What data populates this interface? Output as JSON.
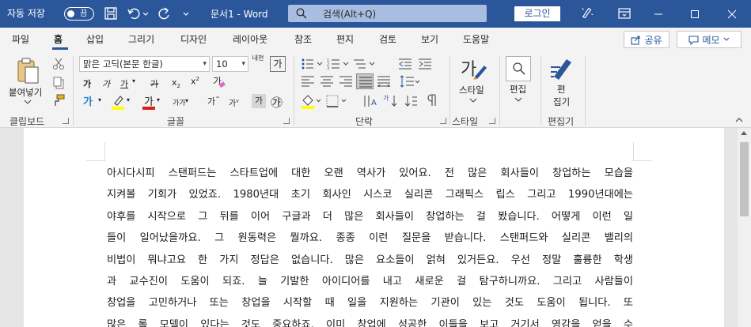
{
  "titlebar": {
    "autosave_label": "자동 저장",
    "autosave_state": "끔",
    "document_title": "문서1 - Word",
    "search_placeholder": "검색(Alt+Q)",
    "login_label": "로그인"
  },
  "tabs": [
    {
      "label": "파일"
    },
    {
      "label": "홈"
    },
    {
      "label": "삽입"
    },
    {
      "label": "그리기"
    },
    {
      "label": "디자인"
    },
    {
      "label": "레이아웃"
    },
    {
      "label": "참조"
    },
    {
      "label": "편지"
    },
    {
      "label": "검토"
    },
    {
      "label": "보기"
    },
    {
      "label": "도움말"
    }
  ],
  "active_tab": "홈",
  "share_label": "공유",
  "memo_label": "메모",
  "ribbon": {
    "clipboard": {
      "paste_label": "붙여넣기",
      "group_label": "클립보드"
    },
    "font": {
      "font_name": "맑은 고딕(본문 한글)",
      "font_size": "10",
      "phonetic": "내천",
      "big_letter": "가",
      "bold": "가",
      "italic": "가",
      "underline": "가",
      "strike": "가",
      "subscript": "x",
      "superscript": "x",
      "highlight_text": "가",
      "font_color_text": "가",
      "char_shading": "가가",
      "grow": "가",
      "shrink": "가",
      "char_border": "가",
      "enclosed": "㉮",
      "group_label": "글꼴"
    },
    "paragraph": {
      "group_label": "단락"
    },
    "styles": {
      "style_label": "스타일",
      "group_label": "스타일"
    },
    "editing": {
      "edit_label": "편집",
      "edit_big_label": "편\n집기",
      "edit_big_l1": "편",
      "edit_big_l2": "집기",
      "group_label": "편집기"
    }
  },
  "document": {
    "lines": [
      "아시다시피 스탠퍼드는 스타트업에 대한 오랜 역사가 있어요. 전 많은 회사들이 창업하는 모습을",
      "지켜볼 기회가 있었죠. 1980년대 초기 회사인 시스코 실리콘 그래픽스 립스 그리고 1990년대에는",
      "야후를 시작으로 그 뒤를 이어 구글과 더 많은 회사들이 창업하는 걸 봤습니다. 어떻게 이런 일",
      "들이 일어났을까요. 그 원동력은 뭘까요. 종종 이런 질문을 받습니다. 스탠퍼드와 실리콘 밸리의",
      "비법이 뭐냐고요 한 가지 정답은 없습니다. 많은 요소들이 얽혀 있거든요. 우선 정말 훌륭한 학생",
      "과 교수진이 도움이 되죠. 늘 기발한 아이디어를 내고 새로운 걸 탐구하니까요. 그리고 사람들이",
      "창업을 고민하거나 또는 창업을 시작할 때 일을 지원하는 기관이 있는 것도 도움이 됩니다. 또",
      "많은 롤 모델이 있다는 것도 중요하죠. 이미 창업에 성공한 이들을 보고 거기서 영감을 얻을 수"
    ]
  }
}
